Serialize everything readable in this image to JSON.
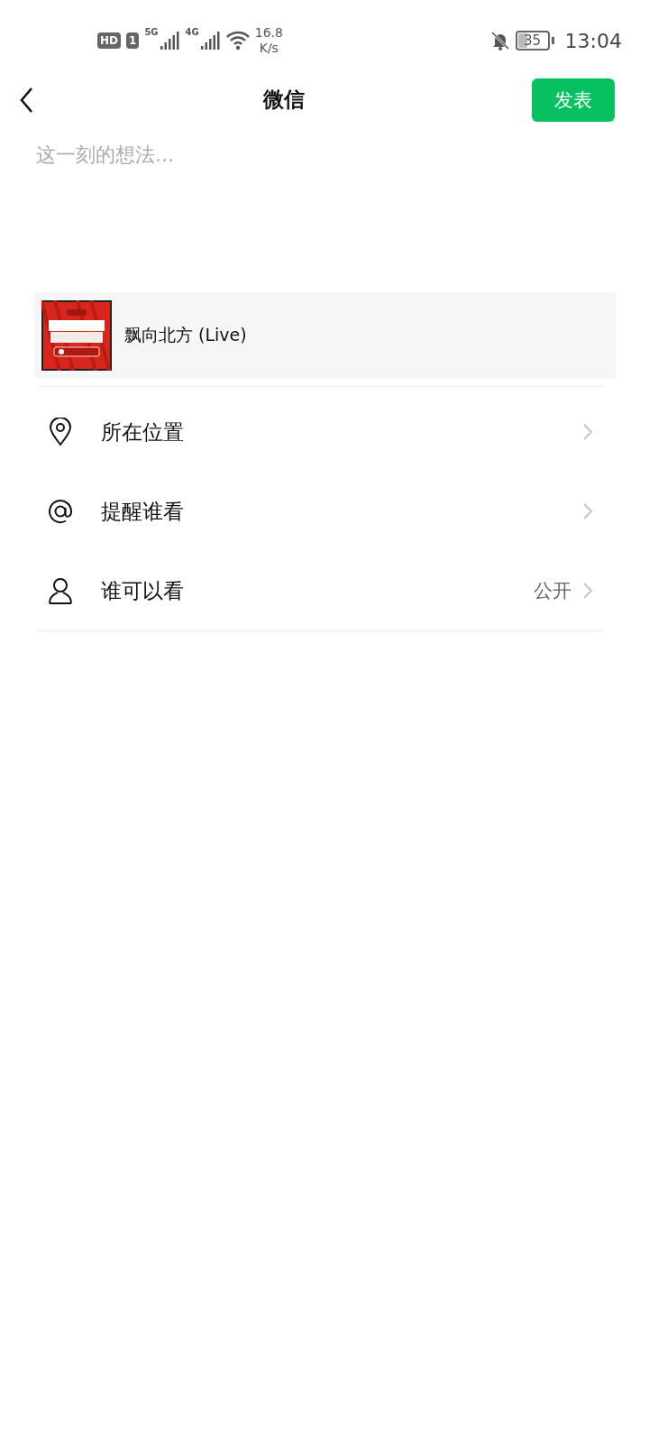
{
  "status_bar": {
    "hd": "HD",
    "sim": "1",
    "network_1": "5G",
    "network_2": "4G",
    "speed_value": "16.8",
    "speed_unit": "K/s",
    "battery": "35",
    "time": "13:04"
  },
  "header": {
    "title": "微信",
    "post_button": "发表"
  },
  "composer": {
    "placeholder": "这一刻的想法..."
  },
  "music_card": {
    "title": "飘向北方 (Live)"
  },
  "options": [
    {
      "kind": "location",
      "label": "所在位置"
    },
    {
      "kind": "mention",
      "label": "提醒谁看"
    },
    {
      "kind": "visibility",
      "label": "谁可以看",
      "value": "公开"
    }
  ]
}
